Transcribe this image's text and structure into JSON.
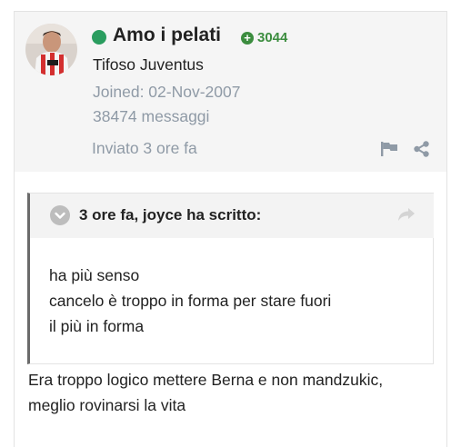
{
  "author": {
    "name": "Amo i pelati",
    "online_color": "#2a9d5f",
    "reputation": "3044",
    "reputation_color": "#3c8d3f",
    "reputation_icon": "plus-circle-icon",
    "group": "Tifoso Juventus",
    "joined": "Joined: 02-Nov-2007",
    "post_count": "38474 messaggi"
  },
  "post": {
    "posted": "Inviato 3 ore fa",
    "actions": [
      "flag-icon",
      "share-icon"
    ],
    "quote": {
      "citation": "3 ore fa, joyce ha scritto:",
      "lines": [
        "ha più senso",
        "cancelo è troppo in forma per stare fuori",
        "il più in forma"
      ]
    },
    "text_lines": [
      "Era troppo logico mettere Berna e non mandzukic,",
      "meglio rovinarsi la vita"
    ]
  }
}
